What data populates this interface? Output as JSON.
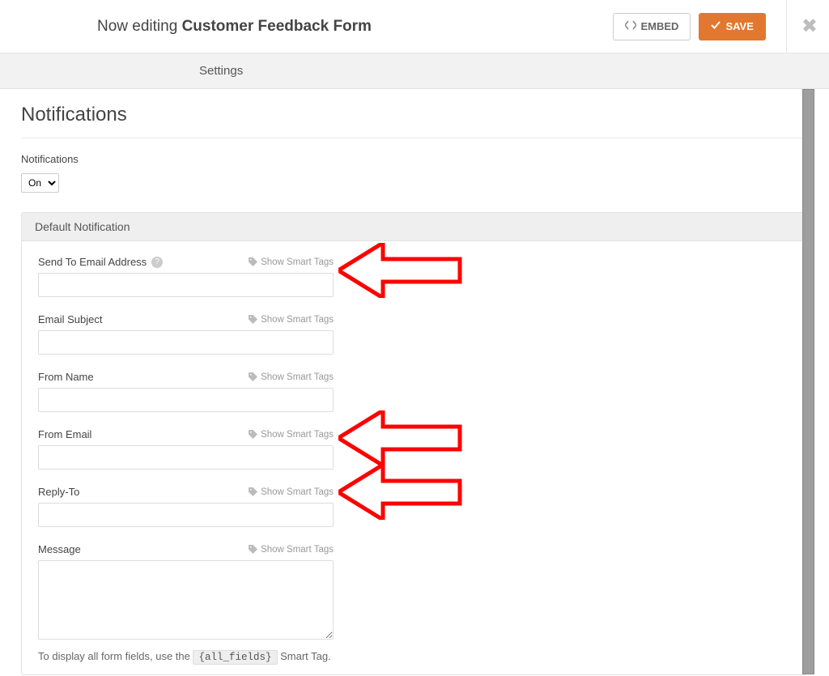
{
  "header": {
    "prefix": "Now editing ",
    "title": "Customer Feedback Form",
    "embed_label": "EMBED",
    "save_label": "SAVE",
    "close_glyph": "✖"
  },
  "nav": {
    "tab": "Settings"
  },
  "page": {
    "heading": "Notifications",
    "toggle_label": "Notifications",
    "toggle_value": "On"
  },
  "panel": {
    "title": "Default Notification",
    "smart_tags_label": "Show Smart Tags",
    "fields": {
      "send_to": {
        "label": "Send To Email Address",
        "value": ""
      },
      "subject": {
        "label": "Email Subject",
        "value": ""
      },
      "from_name": {
        "label": "From Name",
        "value": ""
      },
      "from_email": {
        "label": "From Email",
        "value": ""
      },
      "reply_to": {
        "label": "Reply-To",
        "value": ""
      },
      "message": {
        "label": "Message",
        "value": ""
      }
    },
    "hint_prefix": "To display all form fields, use the ",
    "hint_token": "{all_fields}",
    "hint_suffix": " Smart Tag."
  },
  "annotations": {
    "arrows_point_to": [
      "send_to_input",
      "from_email_input",
      "reply_to_input"
    ],
    "arrow_color": "#ff0000"
  }
}
